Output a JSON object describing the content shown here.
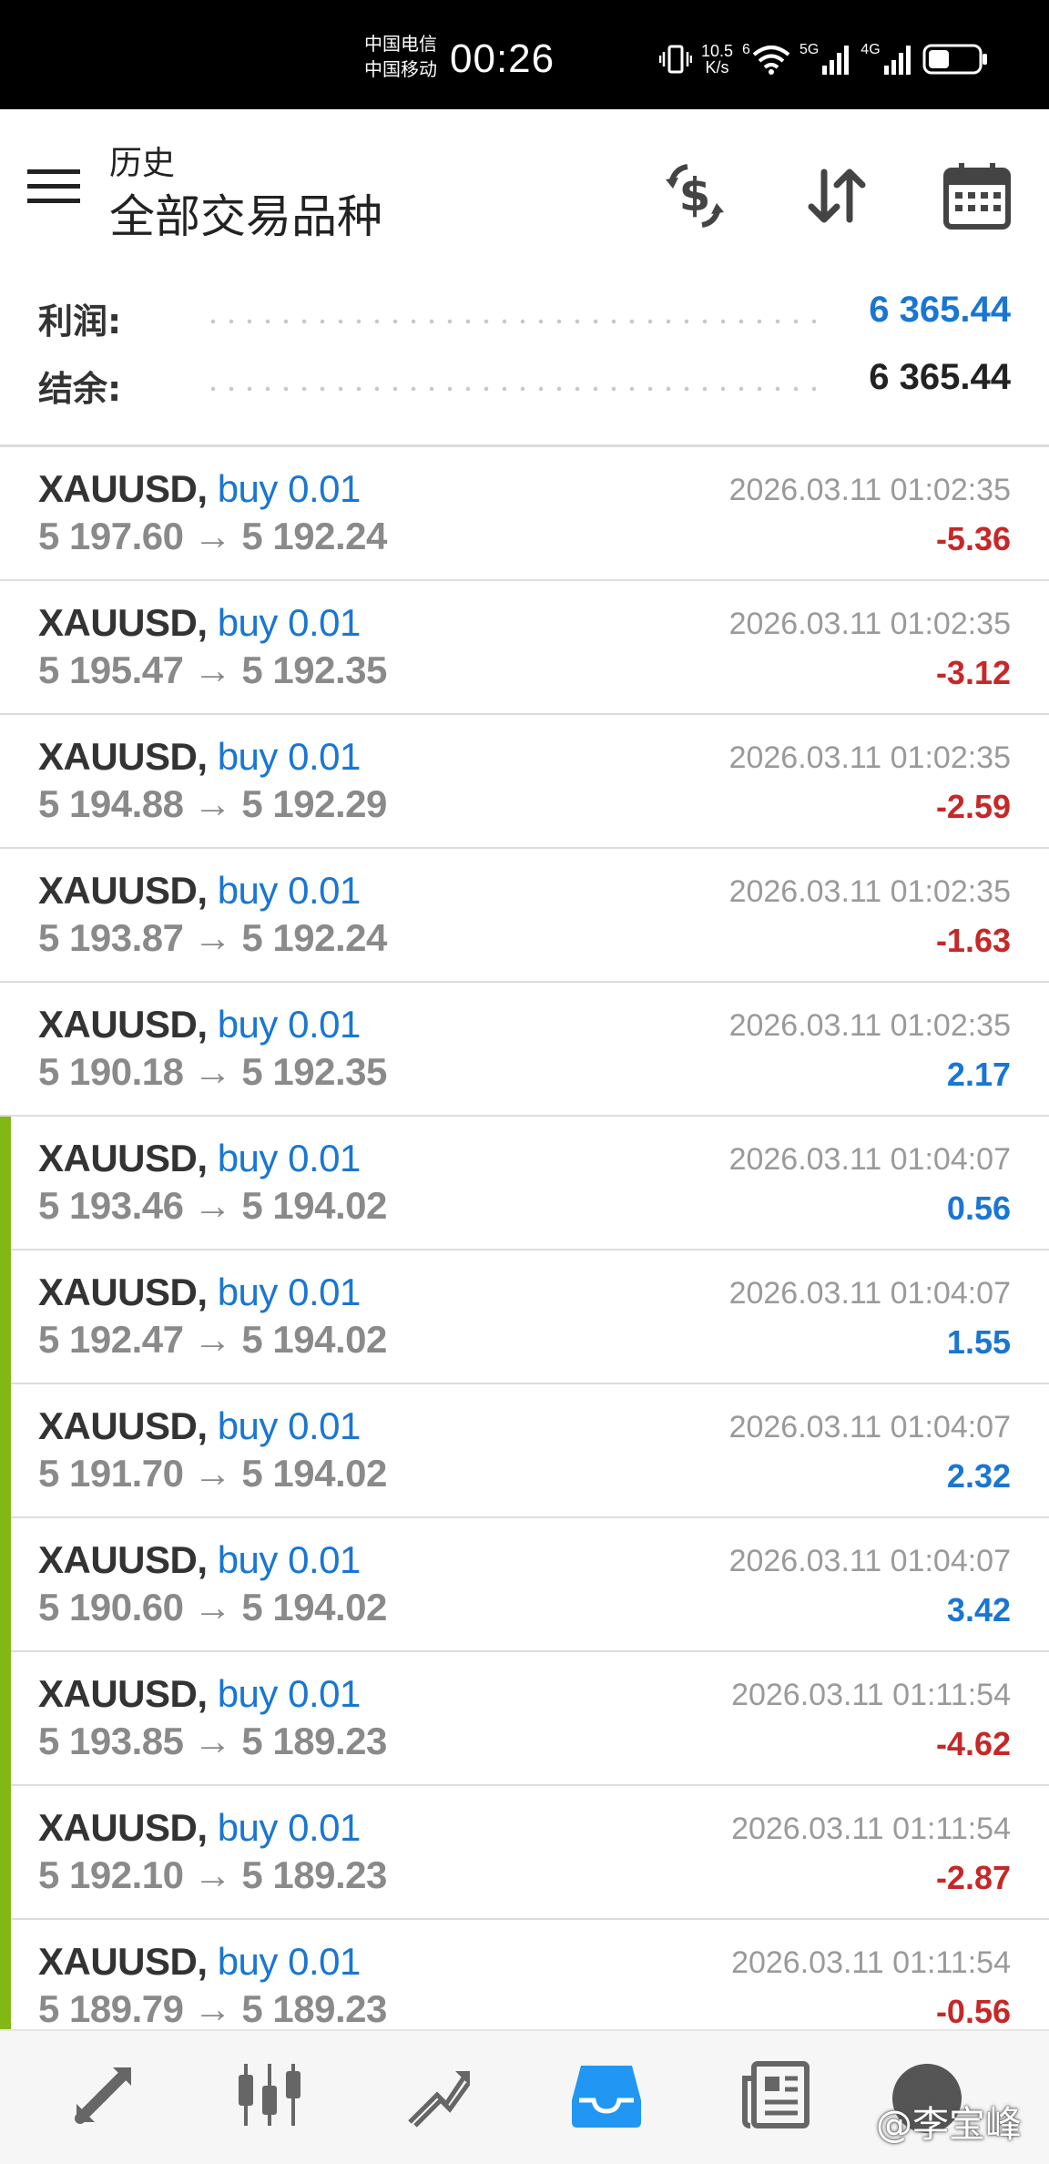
{
  "status_bar": {
    "carrier1": "中国电信",
    "carrier2": "中国移动",
    "time": "00:26",
    "net_speed_value": "10.5",
    "net_speed_unit": "K/s",
    "wifi_tag": "6",
    "signal1_label": "5G",
    "signal2_label": "4G"
  },
  "header": {
    "subtitle": "历史",
    "title": "全部交易品种",
    "icons": [
      "currency-exchange-icon",
      "sort-icon",
      "calendar-icon"
    ]
  },
  "summary": {
    "profit_label": "利润:",
    "profit_value": "6 365.44",
    "balance_label": "结余:",
    "balance_value": "6 365.44",
    "profit_color": "#1976d2"
  },
  "trades": [
    {
      "symbol": "XAUUSD,",
      "side": "buy 0.01",
      "open": "5 197.60",
      "close": "5 192.24",
      "time": "2026.03.11 01:02:35",
      "pl": "-5.36"
    },
    {
      "symbol": "XAUUSD,",
      "side": "buy 0.01",
      "open": "5 195.47",
      "close": "5 192.35",
      "time": "2026.03.11 01:02:35",
      "pl": "-3.12"
    },
    {
      "symbol": "XAUUSD,",
      "side": "buy 0.01",
      "open": "5 194.88",
      "close": "5 192.29",
      "time": "2026.03.11 01:02:35",
      "pl": "-2.59"
    },
    {
      "symbol": "XAUUSD,",
      "side": "buy 0.01",
      "open": "5 193.87",
      "close": "5 192.24",
      "time": "2026.03.11 01:02:35",
      "pl": "-1.63"
    },
    {
      "symbol": "XAUUSD,",
      "side": "buy 0.01",
      "open": "5 190.18",
      "close": "5 192.35",
      "time": "2026.03.11 01:02:35",
      "pl": "2.17"
    },
    {
      "symbol": "XAUUSD,",
      "side": "buy 0.01",
      "open": "5 193.46",
      "close": "5 194.02",
      "time": "2026.03.11 01:04:07",
      "pl": "0.56"
    },
    {
      "symbol": "XAUUSD,",
      "side": "buy 0.01",
      "open": "5 192.47",
      "close": "5 194.02",
      "time": "2026.03.11 01:04:07",
      "pl": "1.55"
    },
    {
      "symbol": "XAUUSD,",
      "side": "buy 0.01",
      "open": "5 191.70",
      "close": "5 194.02",
      "time": "2026.03.11 01:04:07",
      "pl": "2.32"
    },
    {
      "symbol": "XAUUSD,",
      "side": "buy 0.01",
      "open": "5 190.60",
      "close": "5 194.02",
      "time": "2026.03.11 01:04:07",
      "pl": "3.42"
    },
    {
      "symbol": "XAUUSD,",
      "side": "buy 0.01",
      "open": "5 193.85",
      "close": "5 189.23",
      "time": "2026.03.11 01:11:54",
      "pl": "-4.62"
    },
    {
      "symbol": "XAUUSD,",
      "side": "buy 0.01",
      "open": "5 192.10",
      "close": "5 189.23",
      "time": "2026.03.11 01:11:54",
      "pl": "-2.87"
    },
    {
      "symbol": "XAUUSD,",
      "side": "buy 0.01",
      "open": "5 189.79",
      "close": "5 189.23",
      "time": "2026.03.11 01:11:54",
      "pl": "-0.56"
    }
  ],
  "bottom_nav": {
    "items": [
      "quotes-icon",
      "chart-icon",
      "trade-icon",
      "history-icon",
      "news-icon"
    ],
    "active_index": 3,
    "active_color": "#2196f3",
    "watermark": "@李宝峰"
  }
}
